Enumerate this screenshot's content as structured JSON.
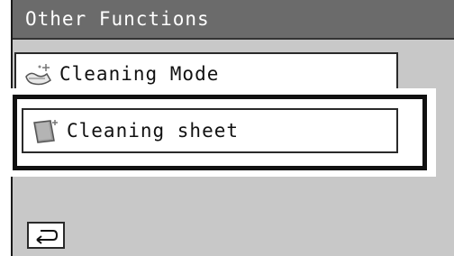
{
  "header": {
    "title": "Other Functions"
  },
  "menu": {
    "items": [
      {
        "label": "Cleaning Mode",
        "icon": "cleaning-mode-icon"
      },
      {
        "label": "Cleaning sheet",
        "icon": "cleaning-sheet-icon"
      }
    ]
  },
  "footer": {
    "back_icon": "return-arrow-icon"
  },
  "colors": {
    "title_bar": "#6b6b6b",
    "screen_bg": "#c8c8c8",
    "button_bg": "#ffffff",
    "highlight_frame": "#111111"
  }
}
